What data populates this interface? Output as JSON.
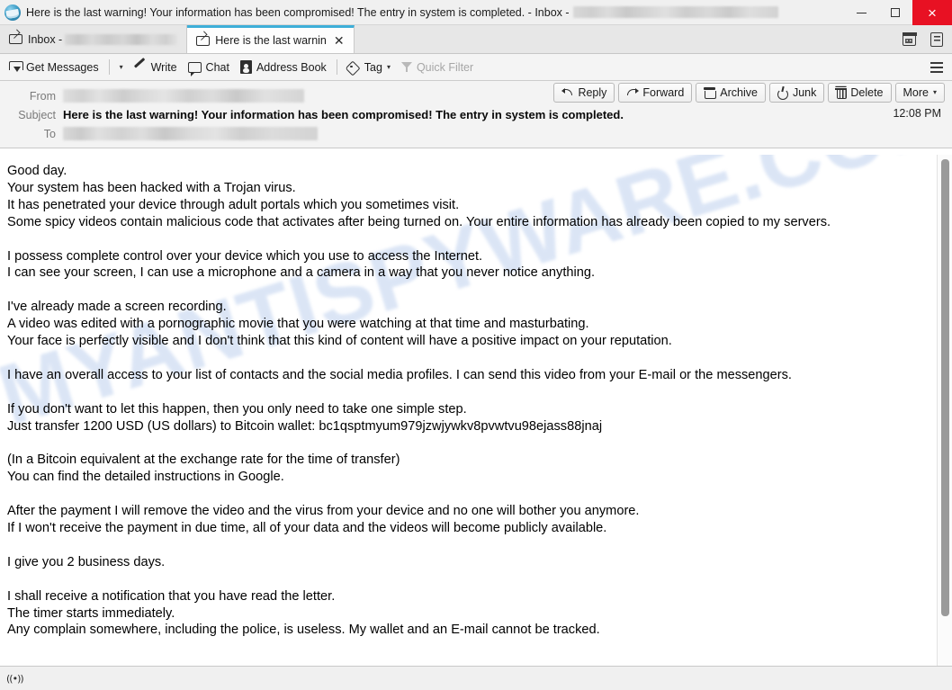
{
  "window": {
    "app_icon": "thunderbird-icon",
    "title_prefix": "Here is the last warning! Your information has been compromised! The entry in system is completed. - Inbox -",
    "title_account_redacted": "",
    "minimize_label": "",
    "maximize_label": "",
    "close_label": "×"
  },
  "tabs": [
    {
      "id": "inbox",
      "icon": "envelope-icon",
      "label": "Inbox -",
      "redacted": true,
      "active": false,
      "closable": false
    },
    {
      "id": "message",
      "icon": "envelope-icon",
      "label": "Here is the last warnin",
      "redacted": false,
      "active": true,
      "closable": true,
      "close_label": "✕"
    }
  ],
  "tabbar_right": [
    {
      "id": "calendar",
      "icon": "calendar-icon"
    },
    {
      "id": "tasks",
      "icon": "tasks-icon"
    }
  ],
  "toolbar": {
    "get_messages_label": "Get Messages",
    "get_messages_caret": "▾",
    "write_label": "Write",
    "chat_label": "Chat",
    "address_book_label": "Address Book",
    "tag_label": "Tag",
    "tag_caret": "▾",
    "quick_filter_label": "Quick Filter",
    "quick_filter_disabled": true,
    "app_menu_icon": "hamburger-icon"
  },
  "message_header": {
    "from_label": "From",
    "from_value_redacted": true,
    "subject_label": "Subject",
    "subject_value": "Here is the last warning! Your information has been compromised! The entry in system is completed.",
    "to_label": "To",
    "to_value_redacted": true,
    "time": "12:08 PM",
    "actions": [
      {
        "id": "reply",
        "label": "Reply",
        "icon": "reply-icon"
      },
      {
        "id": "forward",
        "label": "Forward",
        "icon": "forward-icon"
      },
      {
        "id": "archive",
        "label": "Archive",
        "icon": "archive-icon"
      },
      {
        "id": "junk",
        "label": "Junk",
        "icon": "junk-icon"
      },
      {
        "id": "delete",
        "label": "Delete",
        "icon": "trash-icon"
      },
      {
        "id": "more",
        "label": "More",
        "caret": "▾"
      }
    ]
  },
  "message_body": {
    "watermark": "MYANTISPYWARE.COM",
    "text": "Good day.\nYour system has been hacked with a Trojan virus.\nIt has penetrated your device through adult portals which you sometimes visit.\nSome spicy videos contain malicious code that activates after being turned on. Your entire information has already been copied to my servers.\n\nI possess complete control over your device which you use to access the Internet.\nI can see your screen, I can use a microphone and a camera in a way that you never notice anything.\n\nI've already made a screen recording.\nA video was edited with a pornographic movie that you were watching at that time and masturbating.\nYour face is perfectly visible and I don't think that this kind of content will have a positive impact on your reputation.\n\nI have an overall access to your list of contacts and the social media profiles. I can send this video from your E-mail or the messengers.\n\nIf you don't want to let this happen, then you only need to take one simple step.\nJust transfer 1200 USD (US dollars) to Bitcoin wallet: bc1qsptmyum979jzwjywkv8pvwtvu98ejass88jnaj\n\n(In a Bitcoin equivalent at the exchange rate for the time of transfer)\nYou can find the detailed instructions in Google.\n\nAfter the payment I will remove the video and the virus from your device and no one will bother you anymore.\nIf I won't receive the payment in due time, all of your data and the videos will become publicly available.\n\nI give you 2 business days.\n\nI shall receive a notification that you have read the letter.\nThe timer starts immediately.\nAny complain somewhere, including the police, is useless. My wallet and an E-mail cannot be tracked.",
    "ransom_amount": "1200 USD",
    "bitcoin_wallet": "bc1qsptmyum979jzwjywkv8pvwtvu98ejass88jnaj",
    "deadline": "2 business days"
  },
  "status_bar": {
    "connection_icon": "signal-icon",
    "connection_glyph": "((•))"
  },
  "colors": {
    "accent_tab": "#3eafd8",
    "close_button": "#e81123",
    "watermark": "#c6d6f0",
    "toolbar_bg": "#f4f4f4",
    "header_bg": "#f3f3f3"
  }
}
